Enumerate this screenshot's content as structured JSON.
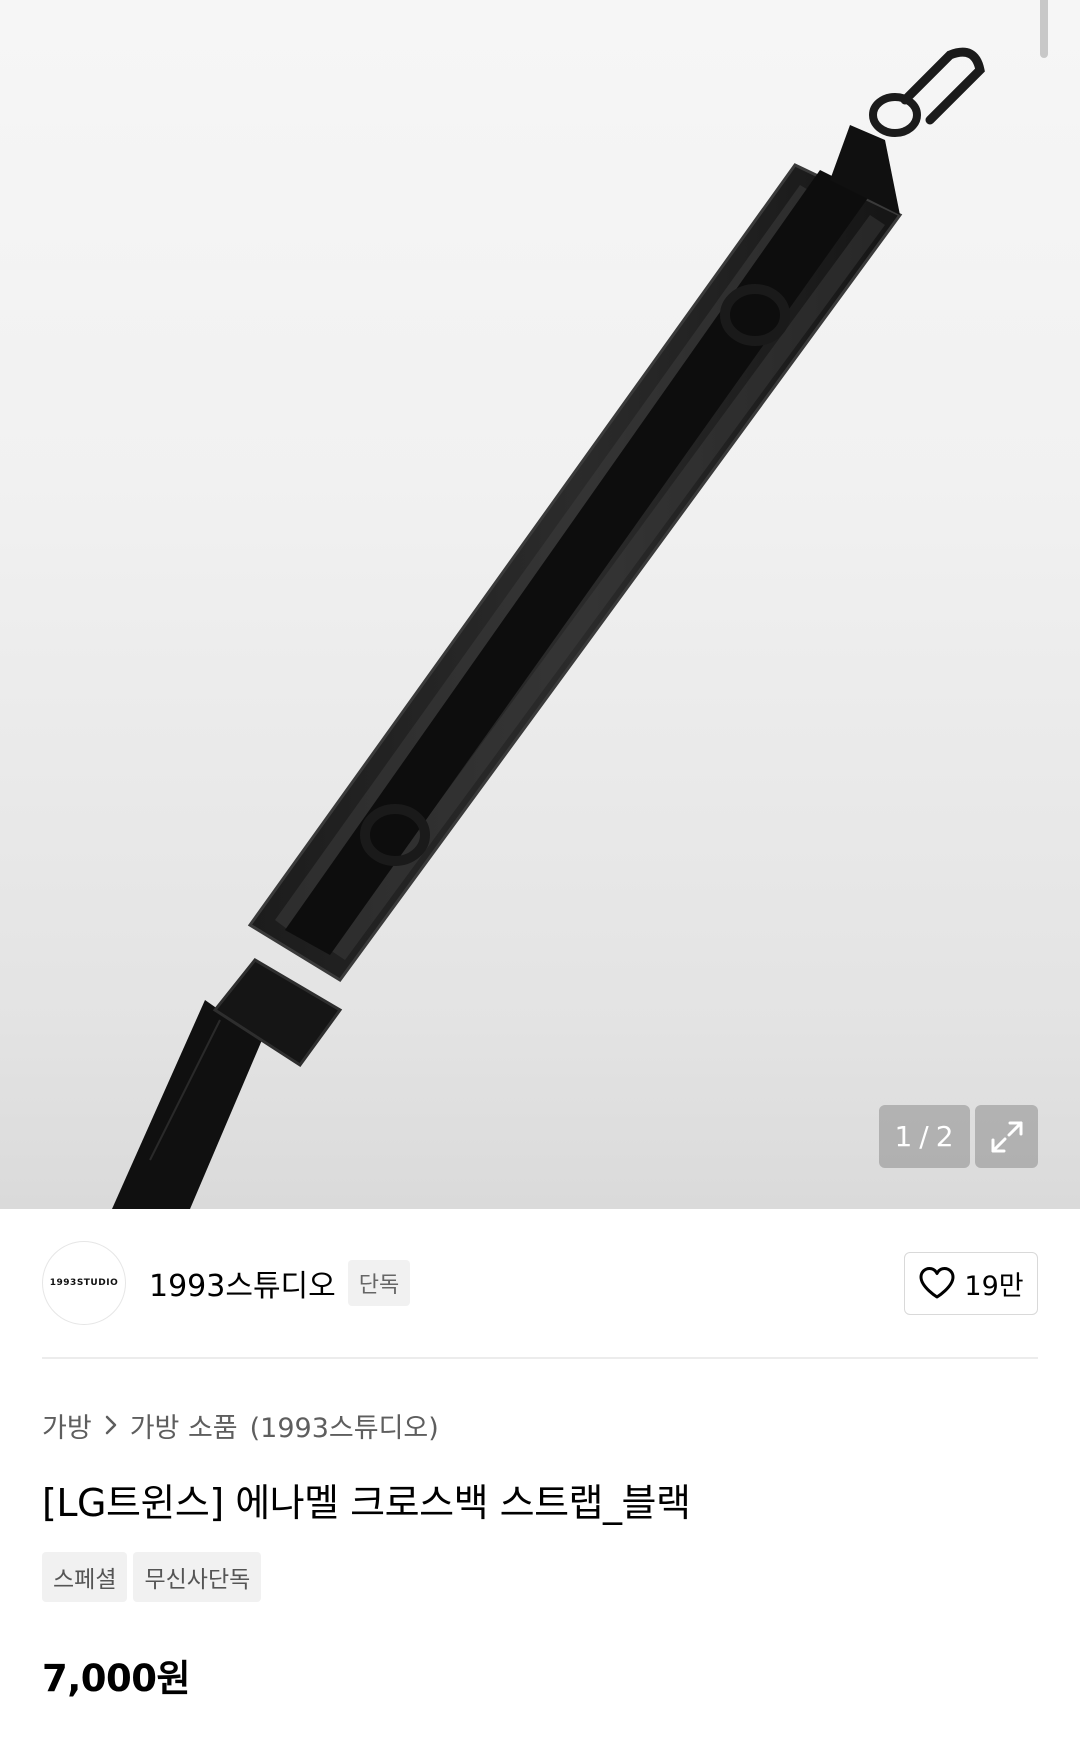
{
  "gallery": {
    "counter_current": "1",
    "counter_separator": "/",
    "counter_total": "2",
    "product_image": "black-enamel-crossbody-strap"
  },
  "brand": {
    "logo_text": "1993STUDIO",
    "name": "1993스튜디오",
    "tag": "단독",
    "like_count": "19만",
    "like_icon": "heart-outline-icon"
  },
  "breadcrumb": {
    "items": [
      "가방",
      "가방 소품"
    ],
    "brand_suffix": "(1993스튜디오)",
    "separator_icon": "chevron-right-icon"
  },
  "product": {
    "title": "[LG트윈스] 에나멜 크로스백 스트랩_블랙",
    "badges": [
      "스페셜",
      "무신사단독"
    ],
    "price": "7,000원"
  },
  "colors": {
    "text_primary": "#000000",
    "text_secondary": "#5e5e5e",
    "badge_bg": "#f1f1f1",
    "divider": "#ececec",
    "overlay_button": "#8c8c8c"
  }
}
